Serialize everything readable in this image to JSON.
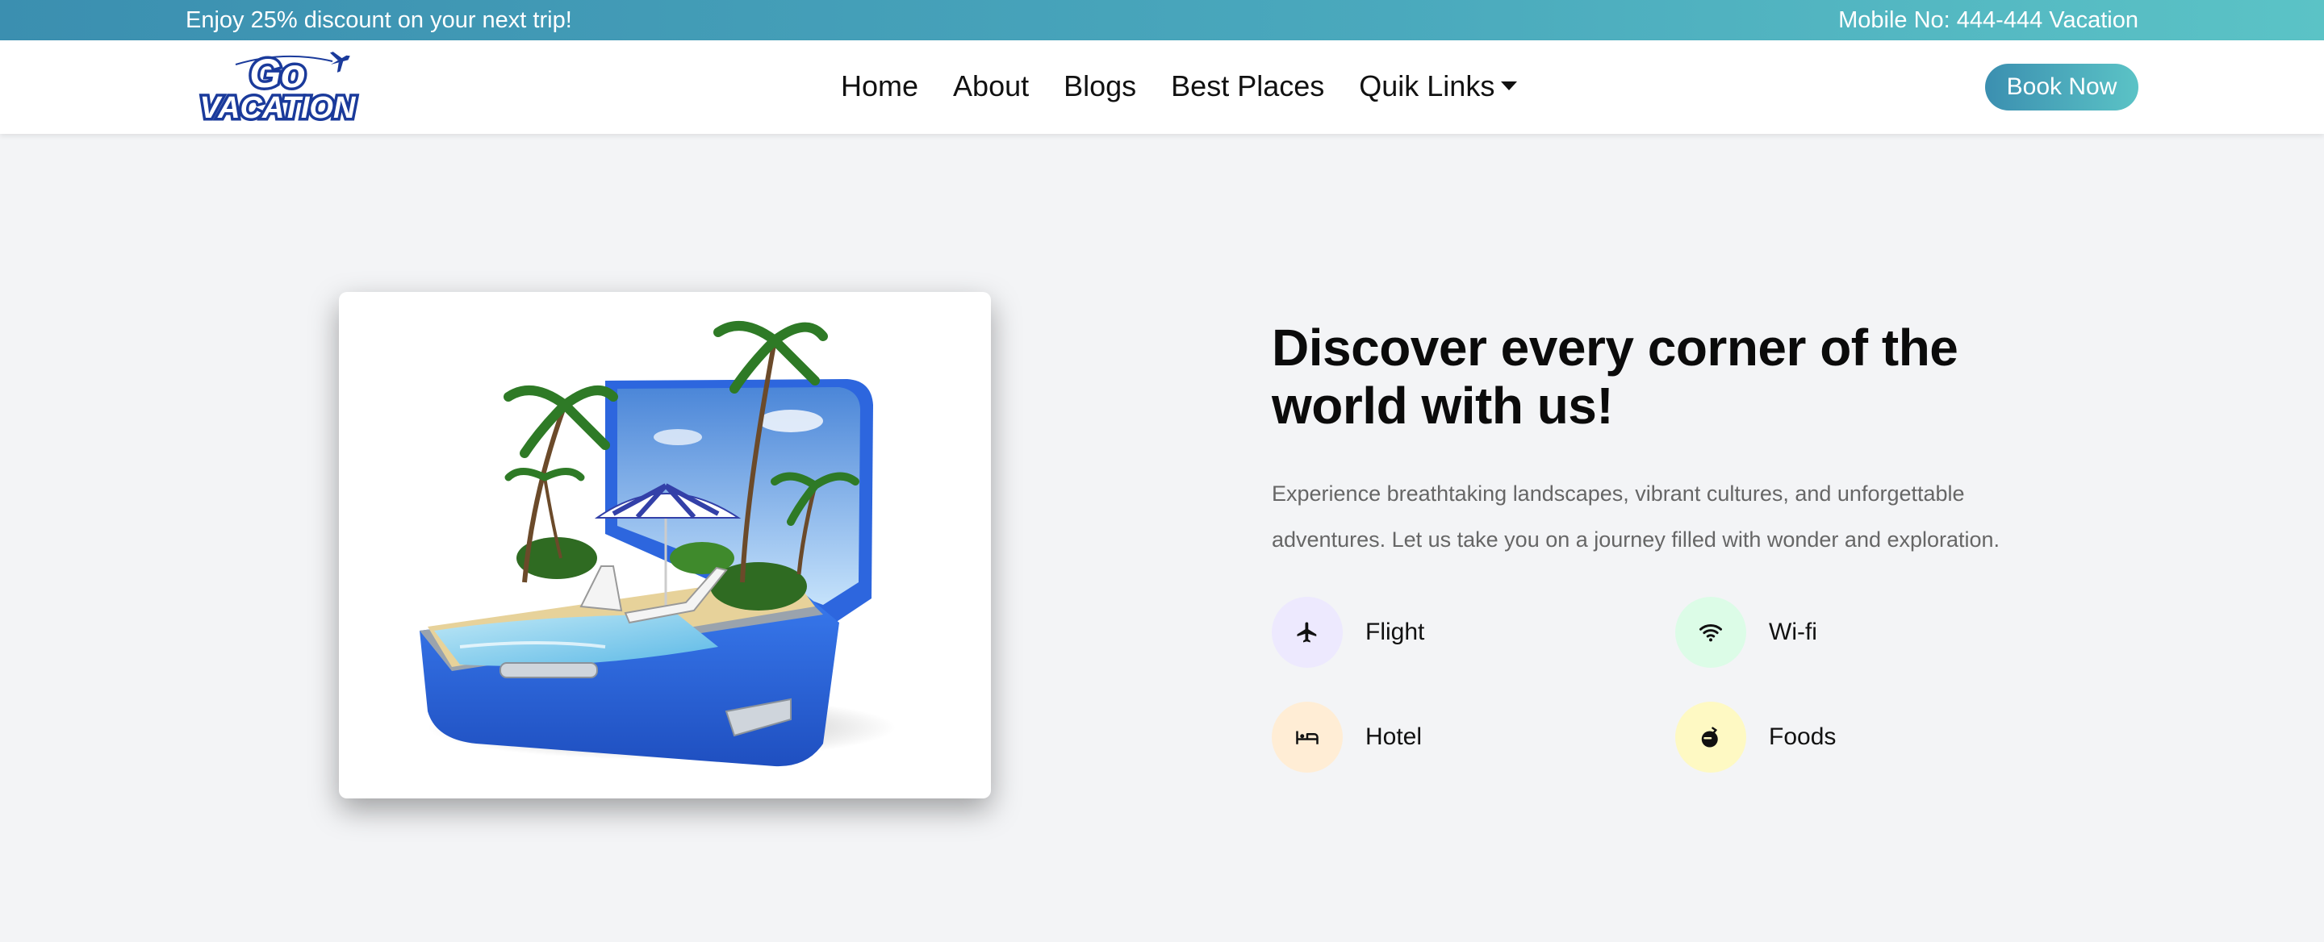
{
  "topbar": {
    "promo": "Enjoy 25% discount on your next trip!",
    "phone": "Mobile No: 444-444 Vacation"
  },
  "brand": {
    "logo_line1": "Go",
    "logo_line2": "VACATION"
  },
  "nav": {
    "items": [
      "Home",
      "About",
      "Blogs",
      "Best Places",
      "Quik Links"
    ],
    "book_label": "Book Now"
  },
  "hero": {
    "heading": "Discover every corner of the world with us!",
    "description": "Experience breathtaking landscapes, vibrant cultures, and unforgettable adventures. Let us take you on a journey filled with wonder and exploration.",
    "features": [
      {
        "label": "Flight",
        "icon": "airplane-icon",
        "bg": "#ede9fe"
      },
      {
        "label": "Wi-fi",
        "icon": "wifi-icon",
        "bg": "#dcfce7"
      },
      {
        "label": "Hotel",
        "icon": "bed-icon",
        "bg": "#ffedd5"
      },
      {
        "label": "Foods",
        "icon": "food-icon",
        "bg": "#fef9c3"
      }
    ]
  },
  "colors": {
    "gradient_start": "#3b8fb0",
    "gradient_end": "#5bc3c6",
    "page_bg": "#f3f4f6"
  }
}
